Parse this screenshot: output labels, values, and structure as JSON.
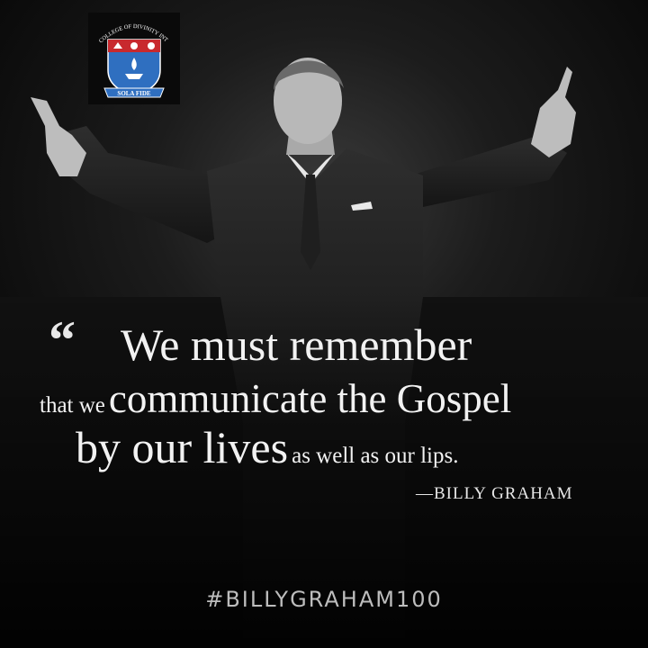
{
  "logo": {
    "arc_text": "COLLEGE OF DIVINITY INTERNATIONAL",
    "motto": "SOLA FIDE",
    "shield_color": "#2f6fc0",
    "band_color": "#c8292e",
    "icon": "lamp-flame-icon"
  },
  "quote": {
    "open_mark": "“",
    "line1": "We must remember",
    "line2_a": "that we",
    "line2_b": "communicate the Gospel",
    "line3_a": "by our lives",
    "line3_b": "as well as our lips.",
    "attribution": "—BILLY GRAHAM"
  },
  "hashtag": "#BILLYGRAHAM100",
  "colors": {
    "background": "#0b0b0b",
    "text": "#f2f2f2",
    "hashtag": "#bdbdbd"
  }
}
